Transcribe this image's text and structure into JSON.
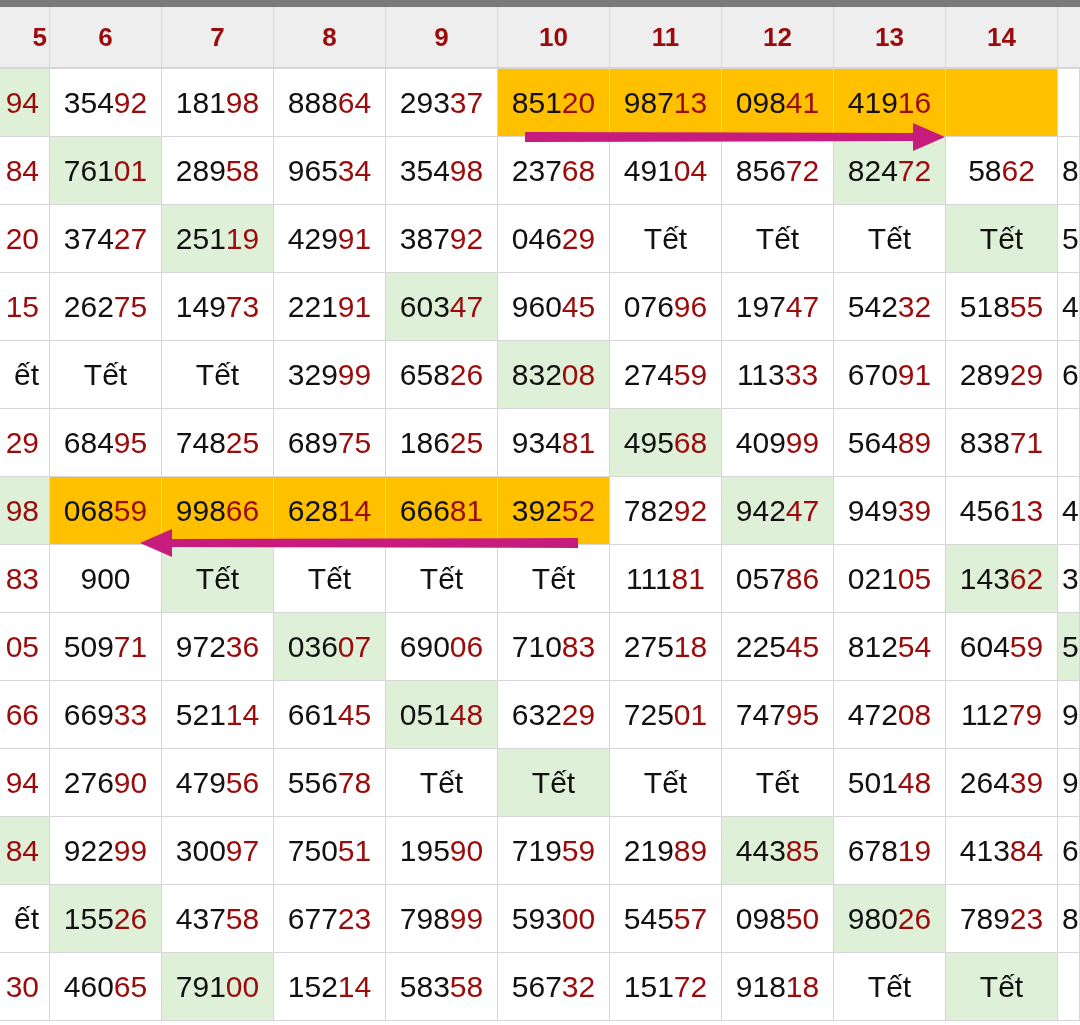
{
  "header": {
    "columns": [
      "5",
      "6",
      "7",
      "8",
      "9",
      "10",
      "11",
      "12",
      "13",
      "14"
    ]
  },
  "rows": [
    {
      "cells": [
        {
          "tail": "94",
          "color": "#dff0d8"
        },
        {
          "lead": "354",
          "tail": "92",
          "color": "#ffffff"
        },
        {
          "lead": "181",
          "tail": "98",
          "color": "#ffffff"
        },
        {
          "lead": "888",
          "tail": "64",
          "color": "#ffffff"
        },
        {
          "lead": "293",
          "tail": "37",
          "color": "#ffffff"
        },
        {
          "lead": "851",
          "tail": "20",
          "color": "#ffc000"
        },
        {
          "lead": "987",
          "tail": "13",
          "color": "#ffc000"
        },
        {
          "lead": "098",
          "tail": "41",
          "color": "#ffc000"
        },
        {
          "lead": "419",
          "tail": "16",
          "color": "#ffc000"
        },
        {
          "color": "#ffc000"
        },
        {
          "color": "#ffffff"
        }
      ]
    },
    {
      "cells": [
        {
          "tail": "84",
          "color": "#ffffff"
        },
        {
          "lead": "761",
          "tail": "01",
          "color": "#dff0d8"
        },
        {
          "lead": "289",
          "tail": "58",
          "color": "#ffffff"
        },
        {
          "lead": "965",
          "tail": "34",
          "color": "#ffffff"
        },
        {
          "lead": "354",
          "tail": "98",
          "color": "#ffffff"
        },
        {
          "lead": "237",
          "tail": "68",
          "color": "#ffffff"
        },
        {
          "lead": "491",
          "tail": "04",
          "color": "#ffffff"
        },
        {
          "lead": "856",
          "tail": "72",
          "color": "#ffffff"
        },
        {
          "lead": "824",
          "tail": "72",
          "color": "#dff0d8"
        },
        {
          "lead": "58",
          "tail": "62",
          "color": "#ffffff"
        },
        {
          "lead": "8",
          "color": "#ffffff"
        }
      ]
    },
    {
      "cells": [
        {
          "tail": "20",
          "color": "#ffffff"
        },
        {
          "lead": "374",
          "tail": "27",
          "color": "#ffffff"
        },
        {
          "lead": "251",
          "tail": "19",
          "color": "#dff0d8"
        },
        {
          "lead": "429",
          "tail": "91",
          "color": "#ffffff"
        },
        {
          "lead": "387",
          "tail": "92",
          "color": "#ffffff"
        },
        {
          "lead": "046",
          "tail": "29",
          "color": "#ffffff"
        },
        {
          "lead": "Tết",
          "color": "#ffffff"
        },
        {
          "lead": "Tết",
          "color": "#ffffff"
        },
        {
          "lead": "Tết",
          "color": "#ffffff"
        },
        {
          "lead": "Tết",
          "color": "#dff0d8"
        },
        {
          "lead": "5",
          "color": "#ffffff"
        }
      ]
    },
    {
      "cells": [
        {
          "tail": "15",
          "color": "#ffffff"
        },
        {
          "lead": "262",
          "tail": "75",
          "color": "#ffffff"
        },
        {
          "lead": "149",
          "tail": "73",
          "color": "#ffffff"
        },
        {
          "lead": "221",
          "tail": "91",
          "color": "#ffffff"
        },
        {
          "lead": "603",
          "tail": "47",
          "color": "#dff0d8"
        },
        {
          "lead": "960",
          "tail": "45",
          "color": "#ffffff"
        },
        {
          "lead": "076",
          "tail": "96",
          "color": "#ffffff"
        },
        {
          "lead": "197",
          "tail": "47",
          "color": "#ffffff"
        },
        {
          "lead": "542",
          "tail": "32",
          "color": "#ffffff"
        },
        {
          "lead": "518",
          "tail": "55",
          "color": "#ffffff"
        },
        {
          "lead": "4",
          "color": "#ffffff"
        }
      ]
    },
    {
      "cells": [
        {
          "lead": "ết",
          "color": "#ffffff"
        },
        {
          "lead": "Tết",
          "color": "#ffffff"
        },
        {
          "lead": "Tết",
          "color": "#ffffff"
        },
        {
          "lead": "329",
          "tail": "99",
          "color": "#ffffff"
        },
        {
          "lead": "658",
          "tail": "26",
          "color": "#ffffff"
        },
        {
          "lead": "832",
          "tail": "08",
          "color": "#dff0d8"
        },
        {
          "lead": "274",
          "tail": "59",
          "color": "#ffffff"
        },
        {
          "lead": "113",
          "tail": "33",
          "color": "#ffffff"
        },
        {
          "lead": "670",
          "tail": "91",
          "color": "#ffffff"
        },
        {
          "lead": "289",
          "tail": "29",
          "color": "#ffffff"
        },
        {
          "lead": "6",
          "color": "#ffffff"
        }
      ]
    },
    {
      "cells": [
        {
          "tail": "29",
          "color": "#ffffff"
        },
        {
          "lead": "684",
          "tail": "95",
          "color": "#ffffff"
        },
        {
          "lead": "748",
          "tail": "25",
          "color": "#ffffff"
        },
        {
          "lead": "689",
          "tail": "75",
          "color": "#ffffff"
        },
        {
          "lead": "186",
          "tail": "25",
          "color": "#ffffff"
        },
        {
          "lead": "934",
          "tail": "81",
          "color": "#ffffff"
        },
        {
          "lead": "495",
          "tail": "68",
          "color": "#dff0d8"
        },
        {
          "lead": "409",
          "tail": "99",
          "color": "#ffffff"
        },
        {
          "lead": "564",
          "tail": "89",
          "color": "#ffffff"
        },
        {
          "lead": "838",
          "tail": "71",
          "color": "#ffffff"
        },
        {
          "color": "#ffffff"
        }
      ]
    },
    {
      "cells": [
        {
          "tail": "98",
          "color": "#dff0d8"
        },
        {
          "lead": "068",
          "tail": "59",
          "color": "#ffc000"
        },
        {
          "lead": "998",
          "tail": "66",
          "color": "#ffc000"
        },
        {
          "lead": "628",
          "tail": "14",
          "color": "#ffc000"
        },
        {
          "lead": "666",
          "tail": "81",
          "color": "#ffc000"
        },
        {
          "lead": "392",
          "tail": "52",
          "color": "#ffc000"
        },
        {
          "lead": "782",
          "tail": "92",
          "color": "#ffffff"
        },
        {
          "lead": "942",
          "tail": "47",
          "color": "#dff0d8"
        },
        {
          "lead": "949",
          "tail": "39",
          "color": "#ffffff"
        },
        {
          "lead": "456",
          "tail": "13",
          "color": "#ffffff"
        },
        {
          "lead": "4",
          "color": "#ffffff"
        }
      ]
    },
    {
      "cells": [
        {
          "tail": "83",
          "color": "#ffffff"
        },
        {
          "lead": "900",
          "color": "#ffffff"
        },
        {
          "lead": "Tết",
          "color": "#dff0d8"
        },
        {
          "lead": "Tết",
          "color": "#ffffff"
        },
        {
          "lead": "Tết",
          "color": "#ffffff"
        },
        {
          "lead": "Tết",
          "color": "#ffffff"
        },
        {
          "lead": "111",
          "tail": "81",
          "color": "#ffffff"
        },
        {
          "lead": "057",
          "tail": "86",
          "color": "#ffffff"
        },
        {
          "lead": "021",
          "tail": "05",
          "color": "#ffffff"
        },
        {
          "lead": "143",
          "tail": "62",
          "color": "#dff0d8"
        },
        {
          "lead": "3",
          "color": "#ffffff"
        }
      ]
    },
    {
      "cells": [
        {
          "tail": "05",
          "color": "#ffffff"
        },
        {
          "lead": "509",
          "tail": "71",
          "color": "#ffffff"
        },
        {
          "lead": "972",
          "tail": "36",
          "color": "#ffffff"
        },
        {
          "lead": "036",
          "tail": "07",
          "color": "#dff0d8"
        },
        {
          "lead": "690",
          "tail": "06",
          "color": "#ffffff"
        },
        {
          "lead": "710",
          "tail": "83",
          "color": "#ffffff"
        },
        {
          "lead": "275",
          "tail": "18",
          "color": "#ffffff"
        },
        {
          "lead": "225",
          "tail": "45",
          "color": "#ffffff"
        },
        {
          "lead": "812",
          "tail": "54",
          "color": "#ffffff"
        },
        {
          "lead": "604",
          "tail": "59",
          "color": "#ffffff"
        },
        {
          "lead": "5",
          "color": "#dff0d8"
        }
      ]
    },
    {
      "cells": [
        {
          "tail": "66",
          "color": "#ffffff"
        },
        {
          "lead": "669",
          "tail": "33",
          "color": "#ffffff"
        },
        {
          "lead": "521",
          "tail": "14",
          "color": "#ffffff"
        },
        {
          "lead": "661",
          "tail": "45",
          "color": "#ffffff"
        },
        {
          "lead": "051",
          "tail": "48",
          "color": "#dff0d8"
        },
        {
          "lead": "632",
          "tail": "29",
          "color": "#ffffff"
        },
        {
          "lead": "725",
          "tail": "01",
          "color": "#ffffff"
        },
        {
          "lead": "747",
          "tail": "95",
          "color": "#ffffff"
        },
        {
          "lead": "472",
          "tail": "08",
          "color": "#ffffff"
        },
        {
          "lead": "112",
          "tail": "79",
          "color": "#ffffff"
        },
        {
          "lead": "9",
          "color": "#ffffff"
        }
      ]
    },
    {
      "cells": [
        {
          "tail": "94",
          "color": "#ffffff"
        },
        {
          "lead": "276",
          "tail": "90",
          "color": "#ffffff"
        },
        {
          "lead": "479",
          "tail": "56",
          "color": "#ffffff"
        },
        {
          "lead": "556",
          "tail": "78",
          "color": "#ffffff"
        },
        {
          "lead": "Tết",
          "color": "#ffffff"
        },
        {
          "lead": "Tết",
          "color": "#dff0d8"
        },
        {
          "lead": "Tết",
          "color": "#ffffff"
        },
        {
          "lead": "Tết",
          "color": "#ffffff"
        },
        {
          "lead": "501",
          "tail": "48",
          "color": "#ffffff"
        },
        {
          "lead": "264",
          "tail": "39",
          "color": "#ffffff"
        },
        {
          "lead": "9",
          "color": "#ffffff"
        }
      ]
    },
    {
      "cells": [
        {
          "tail": "84",
          "color": "#dff0d8"
        },
        {
          "lead": "922",
          "tail": "99",
          "color": "#ffffff"
        },
        {
          "lead": "300",
          "tail": "97",
          "color": "#ffffff"
        },
        {
          "lead": "750",
          "tail": "51",
          "color": "#ffffff"
        },
        {
          "lead": "195",
          "tail": "90",
          "color": "#ffffff"
        },
        {
          "lead": "719",
          "tail": "59",
          "color": "#ffffff"
        },
        {
          "lead": "219",
          "tail": "89",
          "color": "#ffffff"
        },
        {
          "lead": "443",
          "tail": "85",
          "color": "#dff0d8"
        },
        {
          "lead": "678",
          "tail": "19",
          "color": "#ffffff"
        },
        {
          "lead": "413",
          "tail": "84",
          "color": "#ffffff"
        },
        {
          "lead": "6",
          "color": "#ffffff"
        }
      ]
    },
    {
      "cells": [
        {
          "lead": "ết",
          "color": "#ffffff"
        },
        {
          "lead": "155",
          "tail": "26",
          "color": "#dff0d8"
        },
        {
          "lead": "437",
          "tail": "58",
          "color": "#ffffff"
        },
        {
          "lead": "677",
          "tail": "23",
          "color": "#ffffff"
        },
        {
          "lead": "798",
          "tail": "99",
          "color": "#ffffff"
        },
        {
          "lead": "593",
          "tail": "00",
          "color": "#ffffff"
        },
        {
          "lead": "545",
          "tail": "57",
          "color": "#ffffff"
        },
        {
          "lead": "098",
          "tail": "50",
          "color": "#ffffff"
        },
        {
          "lead": "980",
          "tail": "26",
          "color": "#dff0d8"
        },
        {
          "lead": "789",
          "tail": "23",
          "color": "#ffffff"
        },
        {
          "lead": "8",
          "color": "#ffffff"
        }
      ]
    },
    {
      "cells": [
        {
          "tail": "30",
          "color": "#ffffff"
        },
        {
          "lead": "460",
          "tail": "65",
          "color": "#ffffff"
        },
        {
          "lead": "791",
          "tail": "00",
          "color": "#dff0d8"
        },
        {
          "lead": "152",
          "tail": "14",
          "color": "#ffffff"
        },
        {
          "lead": "583",
          "tail": "58",
          "color": "#ffffff"
        },
        {
          "lead": "567",
          "tail": "32",
          "color": "#ffffff"
        },
        {
          "lead": "151",
          "tail": "72",
          "color": "#ffffff"
        },
        {
          "lead": "918",
          "tail": "18",
          "color": "#ffffff"
        },
        {
          "lead": "Tết",
          "color": "#ffffff"
        },
        {
          "lead": "Tết",
          "color": "#dff0d8"
        },
        {
          "color": "#ffffff"
        }
      ]
    }
  ],
  "arrows": [
    {
      "kind": "right"
    },
    {
      "kind": "left"
    }
  ]
}
